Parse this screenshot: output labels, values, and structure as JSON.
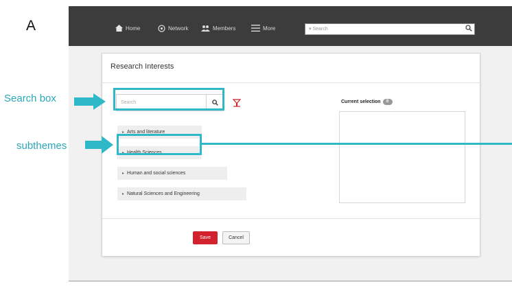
{
  "panel_label": "A",
  "nav": {
    "items": [
      {
        "label": "Home",
        "icon": "home-icon"
      },
      {
        "label": "Network",
        "icon": "network-icon"
      },
      {
        "label": "Members",
        "icon": "members-icon"
      },
      {
        "label": "More",
        "icon": "menu-icon"
      }
    ],
    "search_placeholder": "▾ Search"
  },
  "dialog": {
    "title": "Research Interests",
    "search_placeholder": "Search",
    "categories": [
      "Arts and literature",
      "Health Sciences",
      "Human and social sciences",
      "Natural Sciences and Engineering"
    ],
    "current_selection_label": "Current selection",
    "current_selection_count": "0",
    "save_label": "Save",
    "cancel_label": "Cancel"
  },
  "annotations": {
    "search_box": "Search box",
    "subthemes": "subthemes"
  },
  "colors": {
    "accent": "#2fb9c8",
    "save": "#d2222d",
    "nav_bg": "#3c3c3c"
  }
}
